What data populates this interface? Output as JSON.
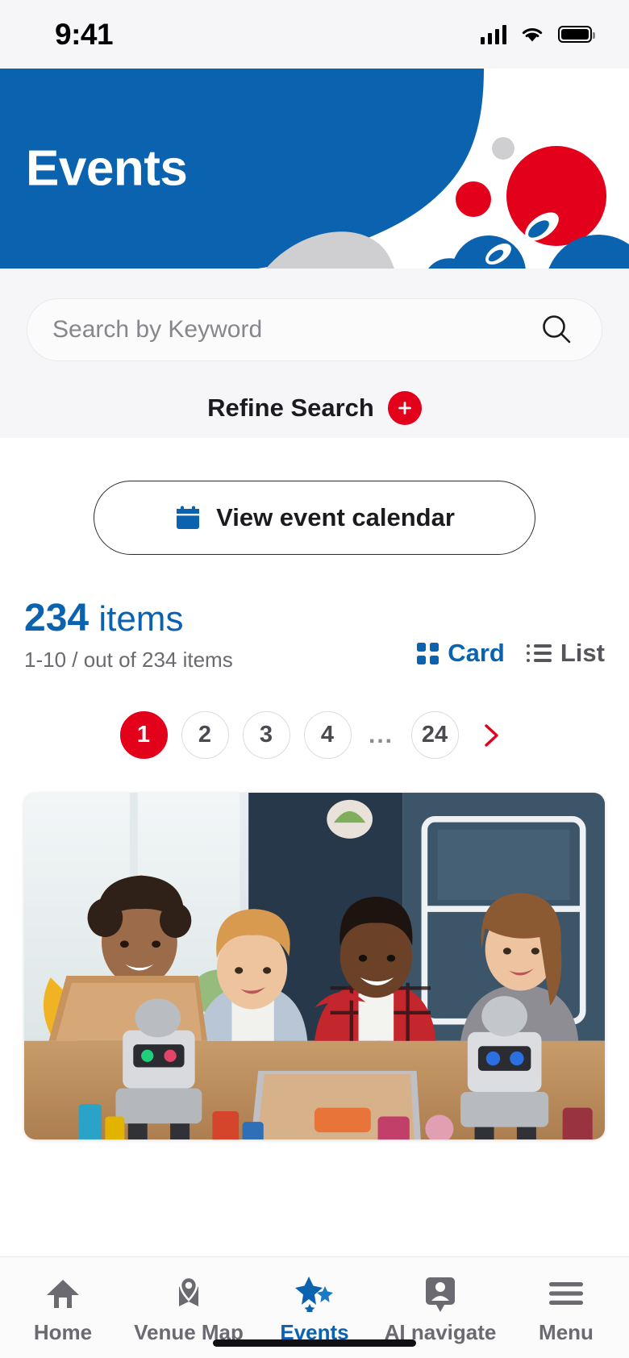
{
  "status_bar": {
    "time": "9:41",
    "icons": [
      "cellular-signal-icon",
      "wifi-icon",
      "battery-icon"
    ]
  },
  "header": {
    "title": "Events",
    "background_color": "#0b63b0",
    "accent_red": "#e2001a",
    "accent_gray": "#cfcfd2"
  },
  "search": {
    "placeholder": "Search by Keyword",
    "value": "",
    "icon": "search-icon",
    "refine_label": "Refine Search",
    "refine_icon": "plus-icon"
  },
  "calendar_button": {
    "label": "View event calendar",
    "icon": "calendar-icon"
  },
  "results": {
    "count": "234",
    "count_unit": "items",
    "range_text": "1-10 / out of 234 items"
  },
  "view_toggle": {
    "options": [
      {
        "label": "Card",
        "icon": "grid-icon",
        "active": true
      },
      {
        "label": "List",
        "icon": "list-icon",
        "active": false
      }
    ]
  },
  "pagination": {
    "pages": [
      "1",
      "2",
      "3",
      "4",
      "...",
      "24"
    ],
    "current": "1",
    "next_icon": "chevron-right-icon",
    "next_color": "#e2001a"
  },
  "event_card": {
    "image_alt": "Four smiling children building and programming robots with laptops in a bright workshop"
  },
  "bottom_nav": {
    "items": [
      {
        "label": "Home",
        "icon": "home-icon",
        "active": false
      },
      {
        "label": "Venue Map",
        "icon": "map-pin-icon",
        "active": false
      },
      {
        "label": "Events",
        "icon": "sparkle-stars-icon",
        "active": true
      },
      {
        "label": "AI navigate",
        "icon": "person-badge-icon",
        "active": false
      },
      {
        "label": "Menu",
        "icon": "hamburger-icon",
        "active": false
      }
    ]
  }
}
